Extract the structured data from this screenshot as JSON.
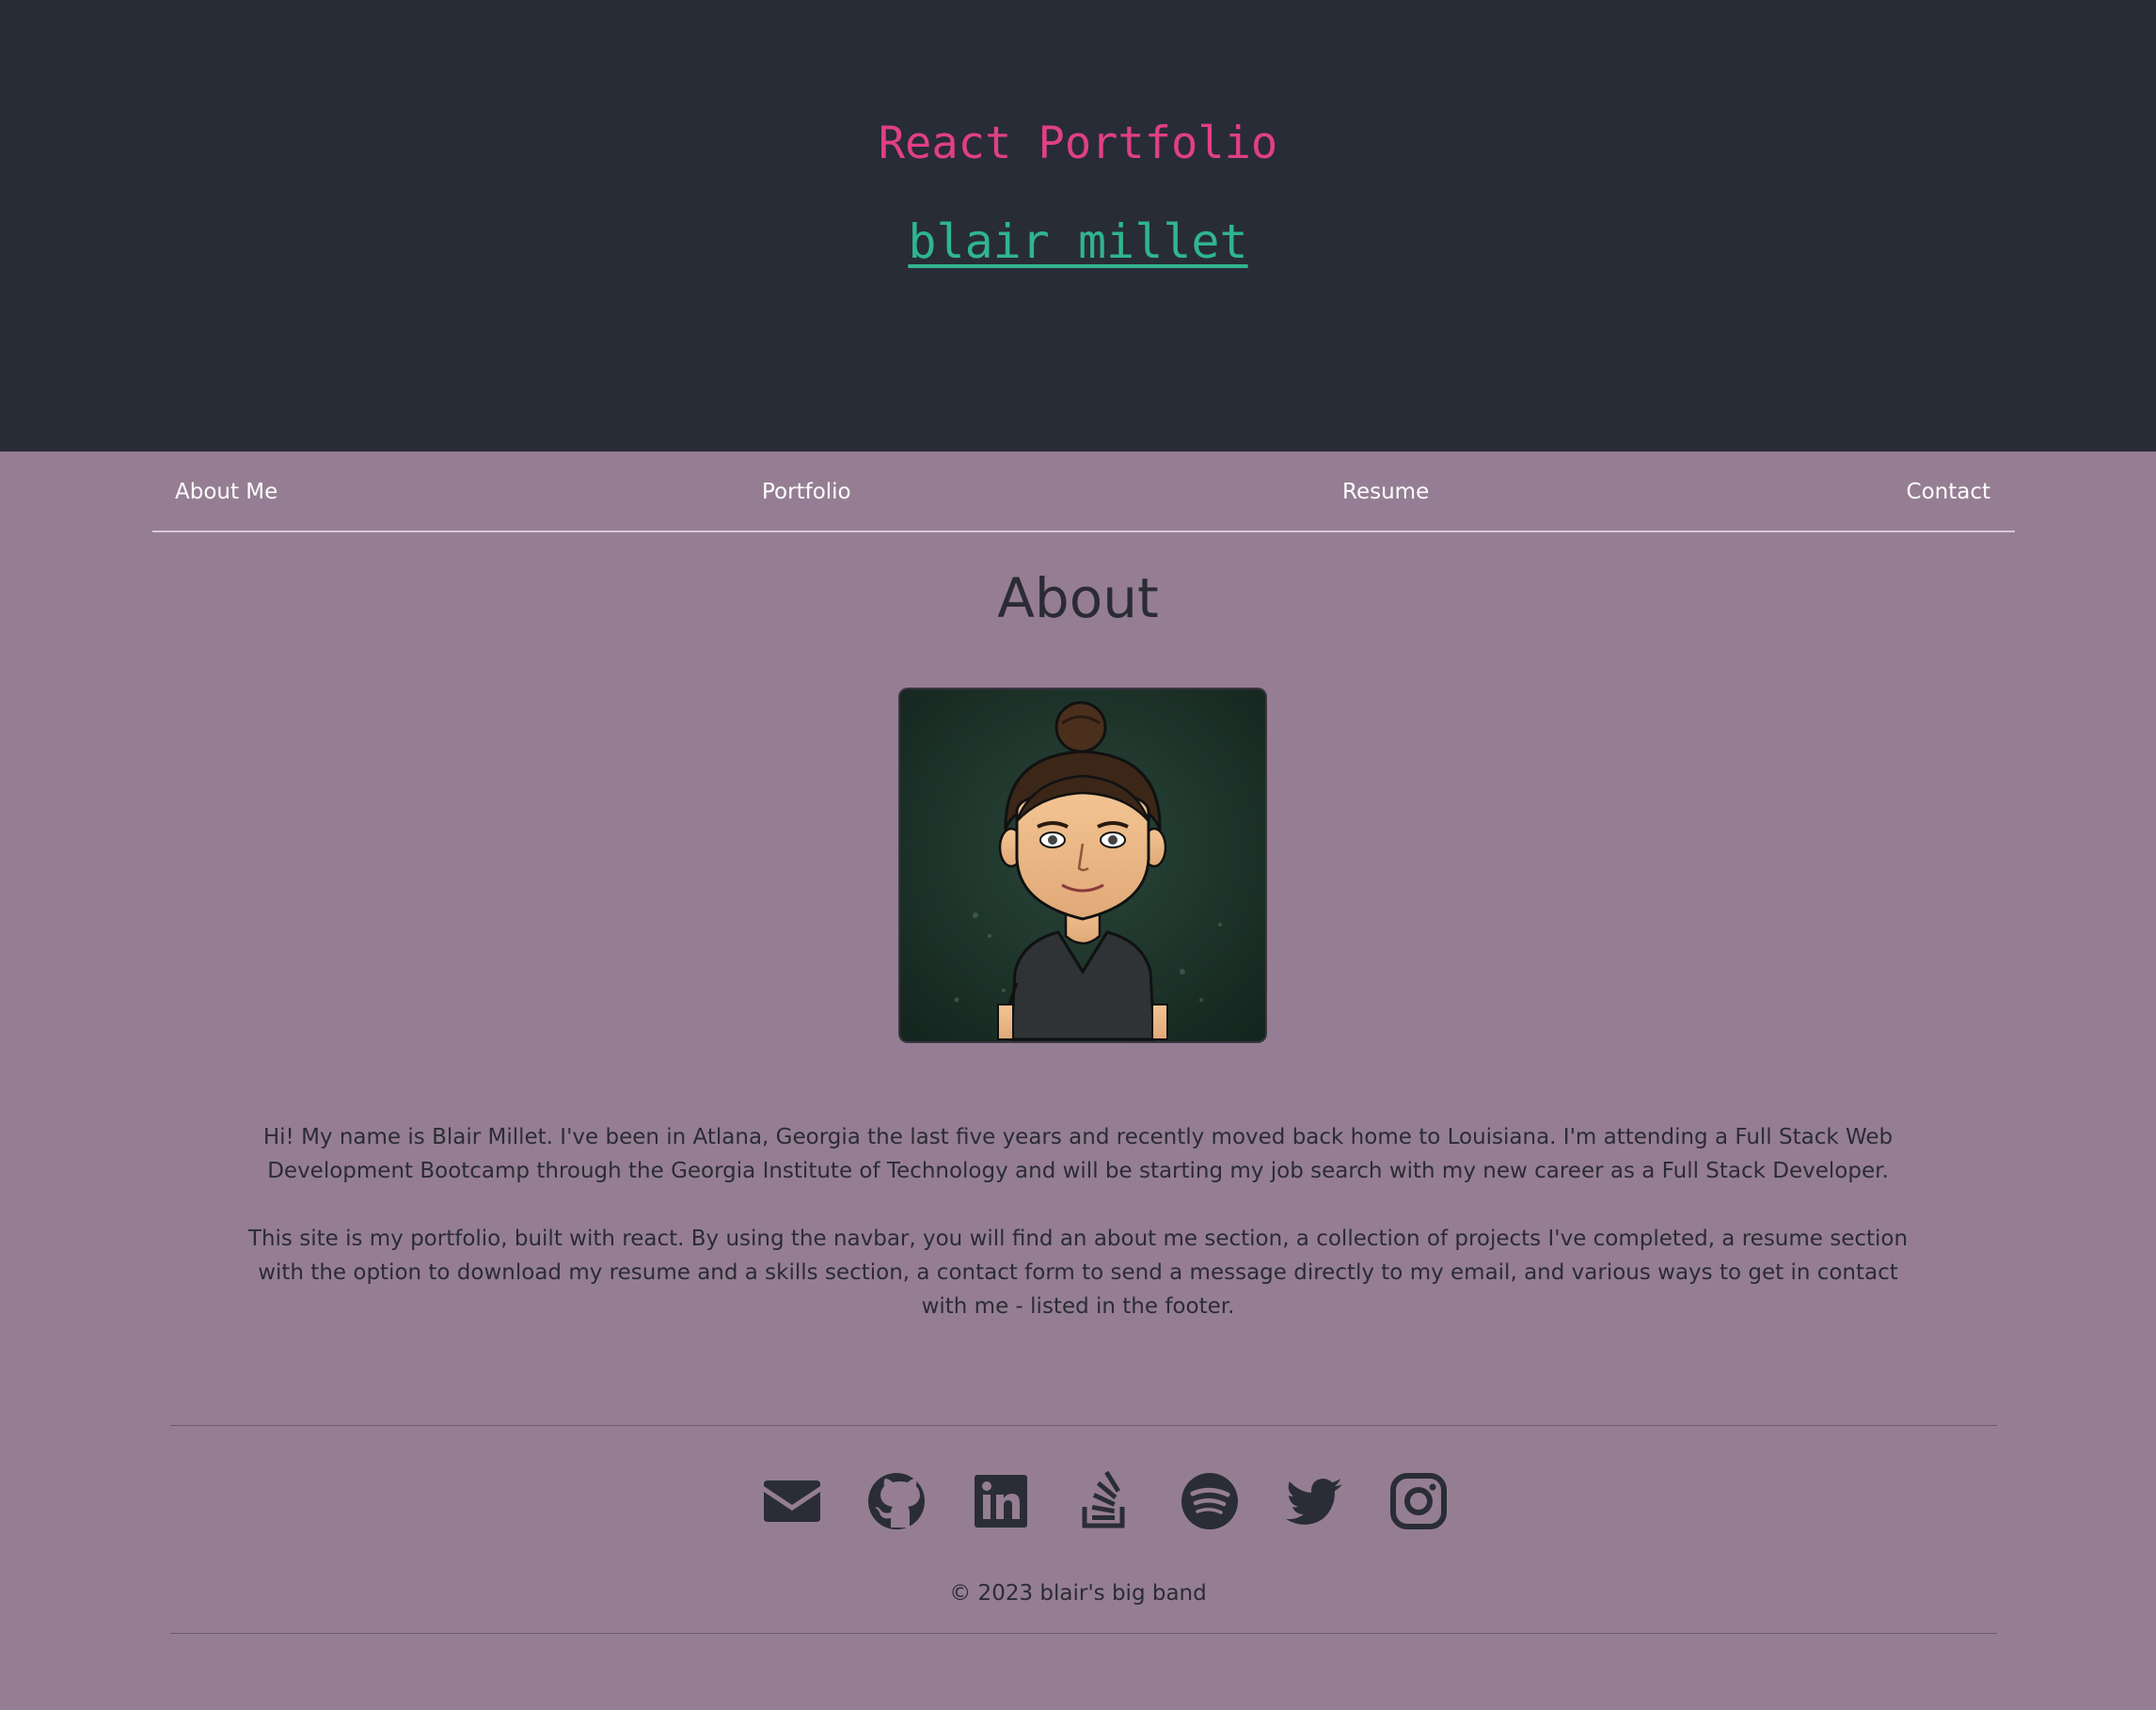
{
  "header": {
    "title": "React Portfolio",
    "name_link": "blair millet"
  },
  "nav": {
    "items": [
      {
        "label": "About Me"
      },
      {
        "label": "Portfolio"
      },
      {
        "label": "Resume"
      },
      {
        "label": "Contact"
      }
    ]
  },
  "about": {
    "heading": "About",
    "paragraphs": [
      "Hi! My name is Blair Millet. I've been in Atlana, Georgia the last five years and recently moved back home to Louisiana. I'm attending a Full Stack Web Development Bootcamp through the Georgia Institute of Technology and will be starting my job search with my new career as a Full Stack Developer.",
      "This site is my portfolio, built with react. By using the navbar, you will find an about me section, a collection of projects I've completed, a resume section with the option to download my resume and a skills section, a contact form to send a message directly to my email, and various ways to get in contact with me - listed in the footer."
    ]
  },
  "footer": {
    "social_icons": [
      "envelope-icon",
      "github-icon",
      "linkedin-icon",
      "stack-overflow-icon",
      "spotify-icon",
      "twitter-icon",
      "instagram-icon"
    ],
    "copyright": "© 2023 blair's big band"
  },
  "colors": {
    "header_bg": "#282c36",
    "page_bg": "#957e93",
    "title_pink": "#e13f87",
    "link_green": "#2fb58f",
    "text_dark": "#2b2b36"
  }
}
